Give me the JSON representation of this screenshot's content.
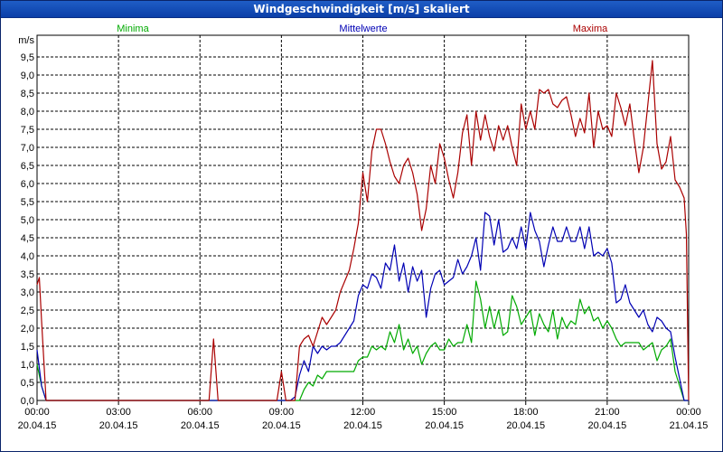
{
  "window": {
    "title": "Windgeschwindigkeit [m/s] skaliert"
  },
  "chart_data": {
    "type": "line",
    "title": "Windgeschwindigkeit [m/s] skaliert",
    "ylabel": "m/s",
    "ylim": [
      0,
      9.5
    ],
    "xlim": [
      "2015-04-20T00:00",
      "2015-04-21T00:00"
    ],
    "grid": true,
    "legend_placement": "top",
    "y_ticks": [
      "0,0",
      "0,5",
      "1,0",
      "1,5",
      "2,0",
      "2,5",
      "3,0",
      "3,5",
      "4,0",
      "4,5",
      "5,0",
      "5,5",
      "6,0",
      "6,5",
      "7,0",
      "7,5",
      "8,0",
      "8,5",
      "9,0",
      "9,5"
    ],
    "x_ticks": [
      {
        "time": "00:00",
        "date": "20.04.15"
      },
      {
        "time": "03:00",
        "date": "20.04.15"
      },
      {
        "time": "06:00",
        "date": "20.04.15"
      },
      {
        "time": "09:00",
        "date": "20.04.15"
      },
      {
        "time": "12:00",
        "date": "20.04.15"
      },
      {
        "time": "15:00",
        "date": "20.04.15"
      },
      {
        "time": "18:00",
        "date": "20.04.15"
      },
      {
        "time": "21:00",
        "date": "20.04.15"
      },
      {
        "time": "00:00",
        "date": "21.04.15"
      }
    ],
    "series": [
      {
        "name": "Minima",
        "color": "#00aa00",
        "points": [
          [
            "00:00",
            1.0
          ],
          [
            "00:10",
            0.4
          ],
          [
            "00:20",
            0.0
          ],
          [
            "09:40",
            0.0
          ],
          [
            "09:50",
            0.3
          ],
          [
            "10:00",
            0.5
          ],
          [
            "10:10",
            0.4
          ],
          [
            "10:20",
            0.7
          ],
          [
            "10:30",
            0.6
          ],
          [
            "10:40",
            0.8
          ],
          [
            "10:50",
            0.8
          ],
          [
            "11:00",
            0.8
          ],
          [
            "11:10",
            0.8
          ],
          [
            "11:20",
            0.8
          ],
          [
            "11:30",
            0.8
          ],
          [
            "11:40",
            0.8
          ],
          [
            "11:50",
            1.1
          ],
          [
            "12:00",
            1.2
          ],
          [
            "12:10",
            1.2
          ],
          [
            "12:20",
            1.5
          ],
          [
            "12:30",
            1.4
          ],
          [
            "12:40",
            1.5
          ],
          [
            "12:50",
            1.4
          ],
          [
            "13:00",
            1.9
          ],
          [
            "13:10",
            1.6
          ],
          [
            "13:20",
            2.1
          ],
          [
            "13:30",
            1.4
          ],
          [
            "13:40",
            1.7
          ],
          [
            "13:50",
            1.3
          ],
          [
            "14:00",
            1.5
          ],
          [
            "14:10",
            1.0
          ],
          [
            "14:20",
            1.3
          ],
          [
            "14:30",
            1.5
          ],
          [
            "14:40",
            1.6
          ],
          [
            "14:50",
            1.4
          ],
          [
            "15:00",
            1.4
          ],
          [
            "15:10",
            1.7
          ],
          [
            "15:20",
            1.5
          ],
          [
            "15:30",
            1.6
          ],
          [
            "15:40",
            1.6
          ],
          [
            "15:50",
            2.1
          ],
          [
            "16:00",
            1.6
          ],
          [
            "16:10",
            3.3
          ],
          [
            "16:20",
            2.8
          ],
          [
            "16:30",
            2.0
          ],
          [
            "16:40",
            2.6
          ],
          [
            "16:50",
            2.0
          ],
          [
            "17:00",
            2.5
          ],
          [
            "17:10",
            1.8
          ],
          [
            "17:20",
            1.9
          ],
          [
            "17:30",
            2.9
          ],
          [
            "17:40",
            2.6
          ],
          [
            "17:50",
            2.1
          ],
          [
            "18:00",
            2.3
          ],
          [
            "18:10",
            2.5
          ],
          [
            "18:20",
            1.8
          ],
          [
            "18:30",
            2.4
          ],
          [
            "18:40",
            2.1
          ],
          [
            "18:50",
            1.9
          ],
          [
            "19:00",
            2.5
          ],
          [
            "19:10",
            1.7
          ],
          [
            "19:20",
            2.3
          ],
          [
            "19:30",
            2.0
          ],
          [
            "19:40",
            2.2
          ],
          [
            "19:50",
            2.1
          ],
          [
            "20:00",
            2.8
          ],
          [
            "20:10",
            2.4
          ],
          [
            "20:20",
            2.6
          ],
          [
            "20:30",
            2.2
          ],
          [
            "20:40",
            2.3
          ],
          [
            "20:50",
            2.0
          ],
          [
            "21:00",
            2.2
          ],
          [
            "21:10",
            2.0
          ],
          [
            "21:20",
            1.7
          ],
          [
            "21:30",
            1.5
          ],
          [
            "21:40",
            1.6
          ],
          [
            "21:50",
            1.6
          ],
          [
            "22:00",
            1.6
          ],
          [
            "22:10",
            1.6
          ],
          [
            "22:20",
            1.4
          ],
          [
            "22:30",
            1.5
          ],
          [
            "22:40",
            1.6
          ],
          [
            "22:50",
            1.1
          ],
          [
            "23:00",
            1.4
          ],
          [
            "23:10",
            1.5
          ],
          [
            "23:20",
            1.7
          ],
          [
            "23:30",
            0.8
          ],
          [
            "23:40",
            0.4
          ],
          [
            "23:50",
            0.0
          ],
          [
            "24:00",
            0.0
          ]
        ]
      },
      {
        "name": "Mittelwerte",
        "color": "#0000b4",
        "points": [
          [
            "00:00",
            1.4
          ],
          [
            "00:10",
            0.4
          ],
          [
            "00:20",
            0.0
          ],
          [
            "09:20",
            0.0
          ],
          [
            "09:30",
            0.1
          ],
          [
            "09:40",
            0.7
          ],
          [
            "09:50",
            1.1
          ],
          [
            "10:00",
            0.8
          ],
          [
            "10:10",
            1.5
          ],
          [
            "10:20",
            1.3
          ],
          [
            "10:30",
            1.5
          ],
          [
            "10:40",
            1.4
          ],
          [
            "10:50",
            1.5
          ],
          [
            "11:00",
            1.5
          ],
          [
            "11:10",
            1.6
          ],
          [
            "11:20",
            1.8
          ],
          [
            "11:30",
            2.0
          ],
          [
            "11:40",
            2.2
          ],
          [
            "11:50",
            2.9
          ],
          [
            "12:00",
            3.2
          ],
          [
            "12:10",
            3.1
          ],
          [
            "12:20",
            3.5
          ],
          [
            "12:30",
            3.4
          ],
          [
            "12:40",
            3.1
          ],
          [
            "12:50",
            3.8
          ],
          [
            "13:00",
            3.6
          ],
          [
            "13:10",
            4.3
          ],
          [
            "13:20",
            3.3
          ],
          [
            "13:30",
            3.8
          ],
          [
            "13:40",
            3.0
          ],
          [
            "13:50",
            3.7
          ],
          [
            "14:00",
            3.3
          ],
          [
            "14:10",
            3.6
          ],
          [
            "14:20",
            2.3
          ],
          [
            "14:30",
            3.1
          ],
          [
            "14:40",
            3.5
          ],
          [
            "14:50",
            3.6
          ],
          [
            "15:00",
            3.2
          ],
          [
            "15:10",
            3.3
          ],
          [
            "15:20",
            3.4
          ],
          [
            "15:30",
            3.9
          ],
          [
            "15:40",
            3.5
          ],
          [
            "15:50",
            3.7
          ],
          [
            "16:00",
            4.0
          ],
          [
            "16:10",
            4.5
          ],
          [
            "16:20",
            3.6
          ],
          [
            "16:30",
            5.2
          ],
          [
            "16:40",
            5.1
          ],
          [
            "16:50",
            4.3
          ],
          [
            "17:00",
            5.0
          ],
          [
            "17:10",
            4.1
          ],
          [
            "17:20",
            4.2
          ],
          [
            "17:30",
            4.5
          ],
          [
            "17:40",
            4.2
          ],
          [
            "17:50",
            4.8
          ],
          [
            "18:00",
            4.2
          ],
          [
            "18:10",
            5.2
          ],
          [
            "18:20",
            4.7
          ],
          [
            "18:30",
            4.4
          ],
          [
            "18:40",
            3.7
          ],
          [
            "18:50",
            4.3
          ],
          [
            "19:00",
            4.8
          ],
          [
            "19:10",
            4.4
          ],
          [
            "19:20",
            4.4
          ],
          [
            "19:30",
            4.8
          ],
          [
            "19:40",
            4.4
          ],
          [
            "19:50",
            4.4
          ],
          [
            "20:00",
            4.8
          ],
          [
            "20:10",
            4.2
          ],
          [
            "20:20",
            4.8
          ],
          [
            "20:30",
            4.0
          ],
          [
            "20:40",
            4.1
          ],
          [
            "20:50",
            4.0
          ],
          [
            "21:00",
            4.2
          ],
          [
            "21:10",
            3.8
          ],
          [
            "21:20",
            2.7
          ],
          [
            "21:30",
            2.8
          ],
          [
            "21:40",
            3.2
          ],
          [
            "21:50",
            2.7
          ],
          [
            "22:00",
            2.5
          ],
          [
            "22:10",
            2.3
          ],
          [
            "22:20",
            2.5
          ],
          [
            "22:30",
            2.1
          ],
          [
            "22:40",
            1.9
          ],
          [
            "22:50",
            2.3
          ],
          [
            "23:00",
            2.2
          ],
          [
            "23:10",
            2.0
          ],
          [
            "23:20",
            1.9
          ],
          [
            "23:30",
            1.2
          ],
          [
            "23:40",
            0.6
          ],
          [
            "23:50",
            0.0
          ],
          [
            "24:00",
            0.0
          ]
        ]
      },
      {
        "name": "Maxima",
        "color": "#aa0000",
        "points": [
          [
            "00:00",
            3.2
          ],
          [
            "00:05",
            3.4
          ],
          [
            "00:10",
            2.2
          ],
          [
            "00:20",
            0.0
          ],
          [
            "06:20",
            0.0
          ],
          [
            "06:30",
            1.7
          ],
          [
            "06:40",
            0.0
          ],
          [
            "08:50",
            0.0
          ],
          [
            "09:00",
            0.8
          ],
          [
            "09:10",
            0.0
          ],
          [
            "09:30",
            0.0
          ],
          [
            "09:40",
            1.5
          ],
          [
            "09:50",
            1.7
          ],
          [
            "10:00",
            1.8
          ],
          [
            "10:10",
            1.5
          ],
          [
            "10:20",
            1.9
          ],
          [
            "10:30",
            2.3
          ],
          [
            "10:40",
            2.1
          ],
          [
            "10:50",
            2.3
          ],
          [
            "11:00",
            2.5
          ],
          [
            "11:10",
            3.0
          ],
          [
            "11:20",
            3.3
          ],
          [
            "11:30",
            3.6
          ],
          [
            "11:40",
            4.2
          ],
          [
            "11:50",
            4.9
          ],
          [
            "12:00",
            6.3
          ],
          [
            "12:10",
            5.5
          ],
          [
            "12:20",
            6.9
          ],
          [
            "12:30",
            7.5
          ],
          [
            "12:40",
            7.5
          ],
          [
            "12:50",
            7.1
          ],
          [
            "13:00",
            6.6
          ],
          [
            "13:10",
            6.2
          ],
          [
            "13:20",
            6.0
          ],
          [
            "13:30",
            6.5
          ],
          [
            "13:40",
            6.7
          ],
          [
            "13:50",
            6.3
          ],
          [
            "14:00",
            5.7
          ],
          [
            "14:10",
            4.7
          ],
          [
            "14:20",
            5.3
          ],
          [
            "14:30",
            6.5
          ],
          [
            "14:40",
            6.0
          ],
          [
            "14:50",
            7.1
          ],
          [
            "15:00",
            6.7
          ],
          [
            "15:10",
            6.1
          ],
          [
            "15:20",
            5.6
          ],
          [
            "15:30",
            6.3
          ],
          [
            "15:40",
            7.4
          ],
          [
            "15:50",
            7.9
          ],
          [
            "16:00",
            6.5
          ],
          [
            "16:10",
            8.0
          ],
          [
            "16:20",
            7.2
          ],
          [
            "16:30",
            7.9
          ],
          [
            "16:40",
            7.3
          ],
          [
            "16:50",
            6.9
          ],
          [
            "17:00",
            7.6
          ],
          [
            "17:10",
            7.2
          ],
          [
            "17:20",
            7.6
          ],
          [
            "17:30",
            7.0
          ],
          [
            "17:40",
            6.5
          ],
          [
            "17:50",
            8.2
          ],
          [
            "18:00",
            7.5
          ],
          [
            "18:10",
            8.0
          ],
          [
            "18:20",
            7.5
          ],
          [
            "18:30",
            8.6
          ],
          [
            "18:40",
            8.5
          ],
          [
            "18:50",
            8.6
          ],
          [
            "19:00",
            8.2
          ],
          [
            "19:10",
            8.1
          ],
          [
            "19:20",
            8.3
          ],
          [
            "19:30",
            8.4
          ],
          [
            "19:40",
            7.9
          ],
          [
            "19:50",
            7.3
          ],
          [
            "20:00",
            7.8
          ],
          [
            "20:10",
            7.4
          ],
          [
            "20:20",
            8.5
          ],
          [
            "20:30",
            7.0
          ],
          [
            "20:40",
            8.0
          ],
          [
            "20:50",
            7.5
          ],
          [
            "21:00",
            7.6
          ],
          [
            "21:10",
            7.3
          ],
          [
            "21:20",
            8.5
          ],
          [
            "21:30",
            8.1
          ],
          [
            "21:40",
            7.6
          ],
          [
            "21:50",
            8.2
          ],
          [
            "22:00",
            7.2
          ],
          [
            "22:10",
            6.3
          ],
          [
            "22:20",
            7.0
          ],
          [
            "22:30",
            8.2
          ],
          [
            "22:40",
            9.4
          ],
          [
            "22:50",
            7.1
          ],
          [
            "23:00",
            6.4
          ],
          [
            "23:10",
            6.6
          ],
          [
            "23:20",
            7.3
          ],
          [
            "23:30",
            6.1
          ],
          [
            "23:40",
            5.9
          ],
          [
            "23:50",
            5.6
          ],
          [
            "23:55",
            4.6
          ],
          [
            "24:00",
            0.0
          ]
        ]
      }
    ]
  }
}
